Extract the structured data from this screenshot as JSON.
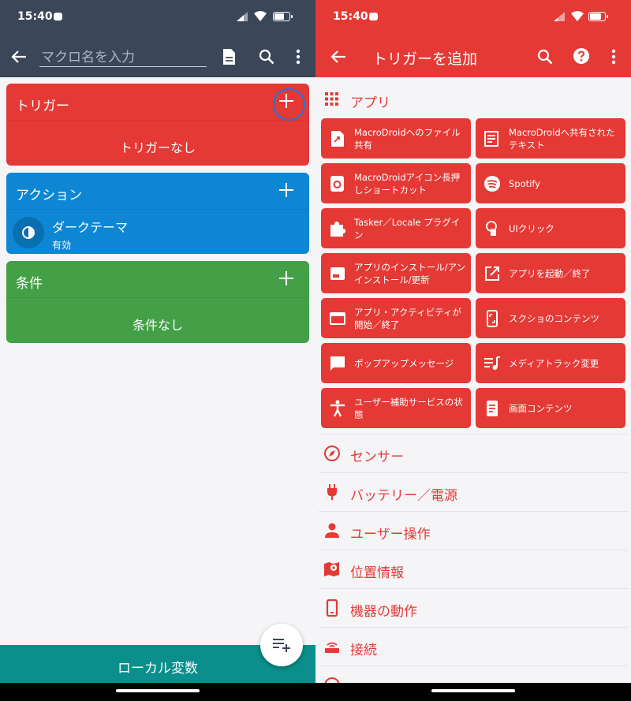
{
  "left": {
    "status": {
      "time": "15:40"
    },
    "toolbar": {
      "macro_name_placeholder": "マクロ名を入力"
    },
    "trigger_card": {
      "title": "トリガー",
      "empty_text": "トリガーなし",
      "color": "#e53935"
    },
    "action_card": {
      "title": "アクション",
      "color": "#0d87d4",
      "items": [
        {
          "name": "ダークテーマ",
          "status": "有効",
          "icon": "contrast-icon"
        }
      ]
    },
    "condition_card": {
      "title": "条件",
      "empty_text": "条件なし",
      "color": "#43a047"
    },
    "local_variables_label": "ローカル変数"
  },
  "right": {
    "status": {
      "time": "15:40"
    },
    "toolbar": {
      "title": "トリガーを追加"
    },
    "apps_section": {
      "label": "アプリ",
      "icon": "grid-icon"
    },
    "tiles": [
      {
        "label": "MacroDroidへのファイル共有",
        "icon": "file-share-icon"
      },
      {
        "label": "MacroDroidへ共有されたテキスト",
        "icon": "shared-text-icon"
      },
      {
        "label": "MacroDroidアイコン長押しショートカット",
        "icon": "long-press-icon"
      },
      {
        "label": "Spotify",
        "icon": "spotify-icon"
      },
      {
        "label": "Tasker／Locale プラグイン",
        "icon": "puzzle-icon"
      },
      {
        "label": "UIクリック",
        "icon": "touch-icon"
      },
      {
        "label": "アプリのインストール/アンインストール/更新",
        "icon": "app-install-icon"
      },
      {
        "label": "アプリを起動／終了",
        "icon": "open-in-new-icon"
      },
      {
        "label": "アプリ・アクティビティが開始／終了",
        "icon": "window-icon"
      },
      {
        "label": "スクショのコンテンツ",
        "icon": "screenshot-icon"
      },
      {
        "label": "ポップアップメッセージ",
        "icon": "message-icon"
      },
      {
        "label": "メディアトラック変更",
        "icon": "playlist-icon"
      },
      {
        "label": "ユーザー補助サービスの状態",
        "icon": "accessibility-icon"
      },
      {
        "label": "画面コンテンツ",
        "icon": "screen-content-icon"
      }
    ],
    "categories": [
      {
        "label": "センサー",
        "icon": "compass-icon"
      },
      {
        "label": "バッテリー／電源",
        "icon": "plug-icon"
      },
      {
        "label": "ユーザー操作",
        "icon": "person-icon"
      },
      {
        "label": "位置情報",
        "icon": "map-pin-icon"
      },
      {
        "label": "機器の動作",
        "icon": "phone-icon"
      },
      {
        "label": "接続",
        "icon": "router-icon"
      }
    ],
    "accent_color": "#e53935"
  }
}
